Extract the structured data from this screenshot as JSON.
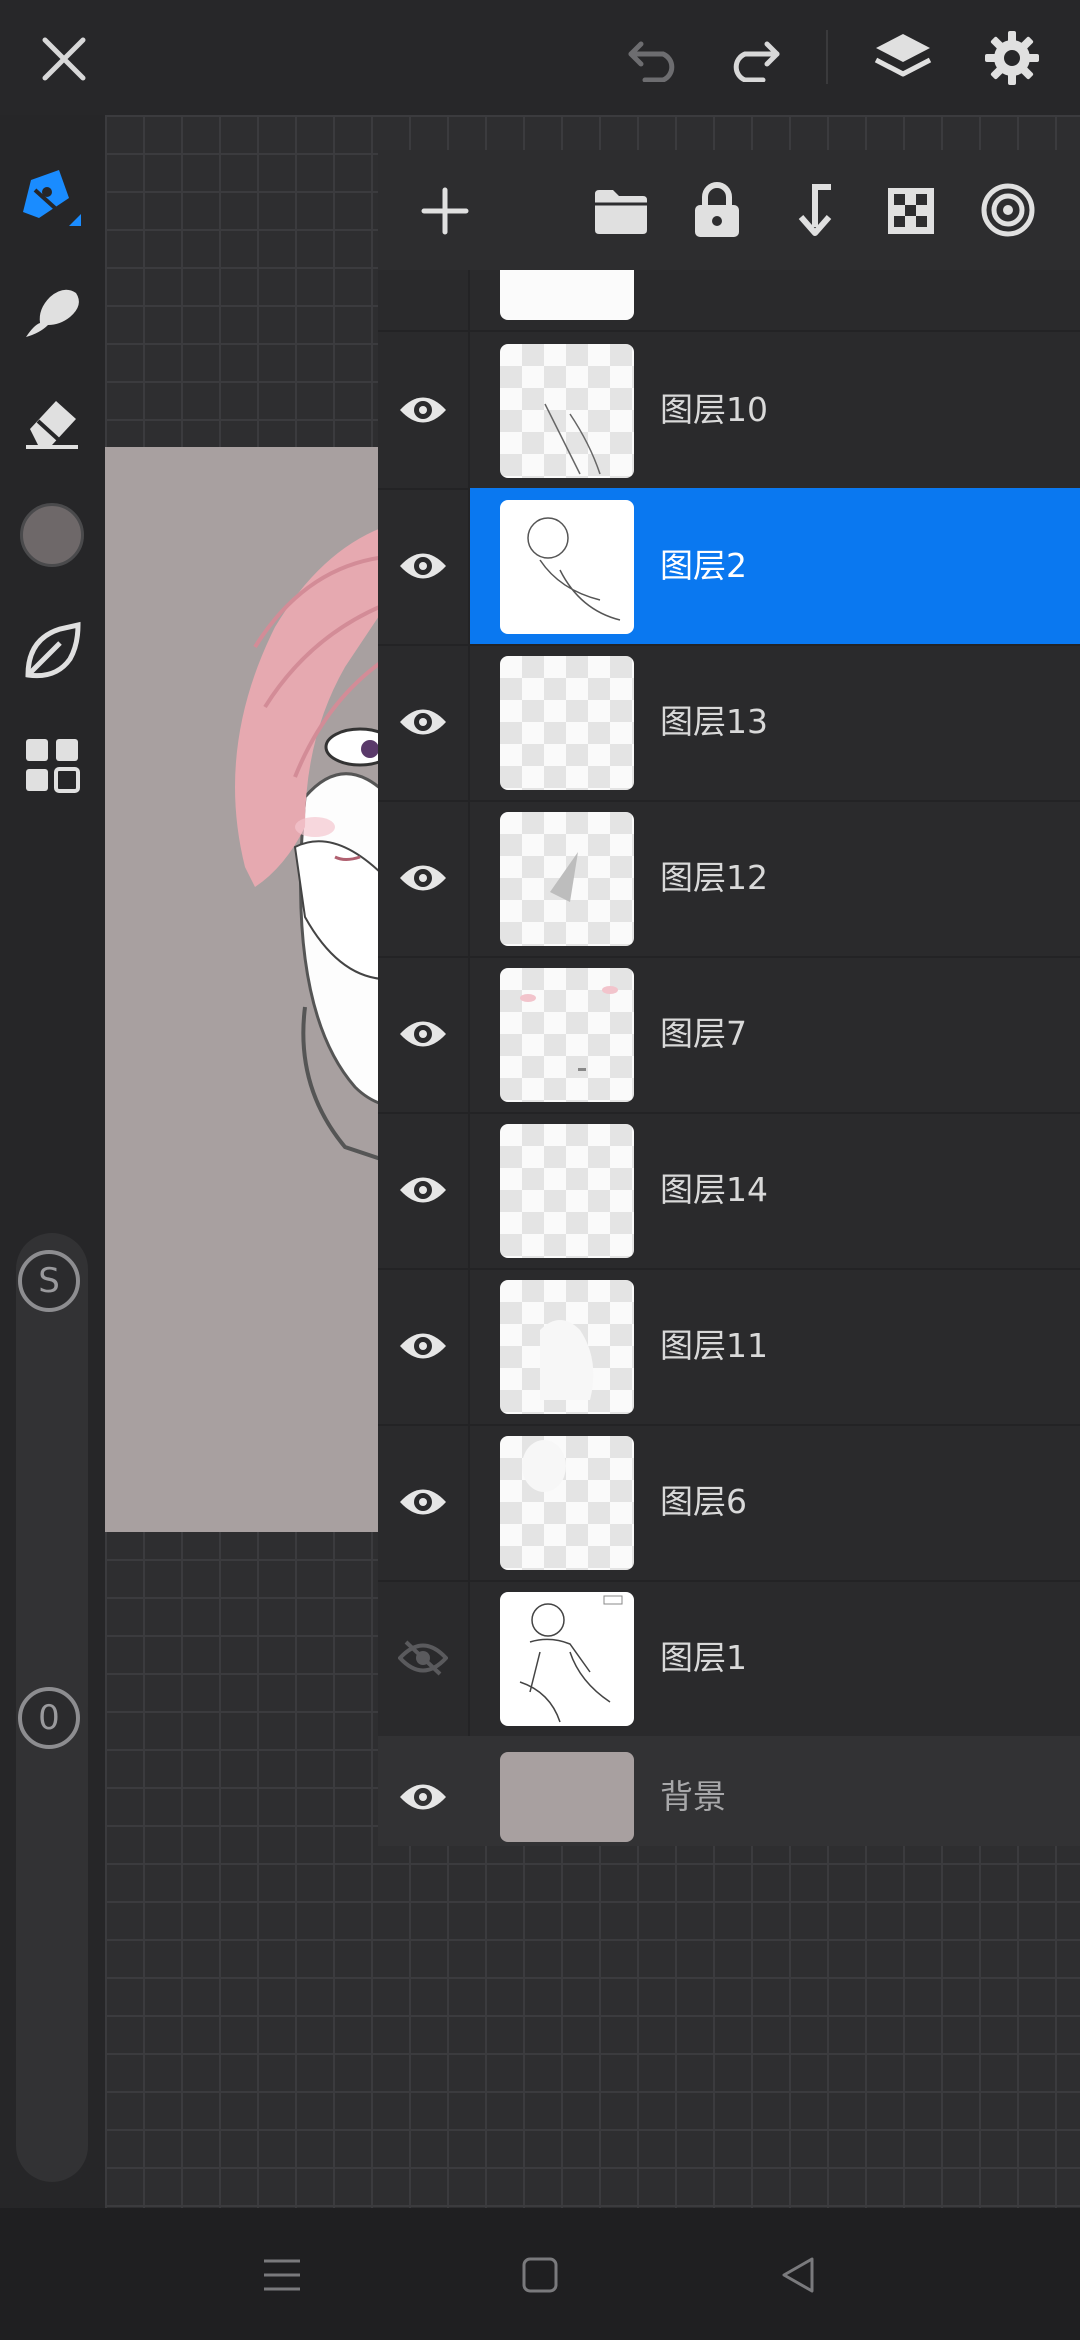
{
  "topbar": {
    "close_icon": "close-icon",
    "undo_icon": "undo-icon",
    "redo_icon": "redo-icon",
    "layers_icon": "layers-icon",
    "settings_icon": "gear-icon"
  },
  "sidebar": {
    "tools": [
      "pen-tool",
      "smudge-tool",
      "eraser-tool",
      "color-swatch",
      "leaf-tool",
      "grid-tool"
    ],
    "current_color": "#6e6869",
    "size_slider_label": "S",
    "opacity_slider_label": "0"
  },
  "layers_panel": {
    "toolbar": [
      "add",
      "folder",
      "lock",
      "merge-down",
      "transparency",
      "target"
    ],
    "layers": [
      {
        "name": "图层10",
        "visible": true,
        "selected": false
      },
      {
        "name": "图层2",
        "visible": true,
        "selected": true
      },
      {
        "name": "图层13",
        "visible": true,
        "selected": false
      },
      {
        "name": "图层12",
        "visible": true,
        "selected": false
      },
      {
        "name": "图层7",
        "visible": true,
        "selected": false
      },
      {
        "name": "图层14",
        "visible": true,
        "selected": false
      },
      {
        "name": "图层11",
        "visible": true,
        "selected": false
      },
      {
        "name": "图层6",
        "visible": true,
        "selected": false
      },
      {
        "name": "图层1",
        "visible": false,
        "selected": false
      }
    ],
    "background_layer": {
      "name": "背景",
      "visible": true,
      "color": "#a8a0a0"
    }
  },
  "accent_color": "#0a78f0"
}
